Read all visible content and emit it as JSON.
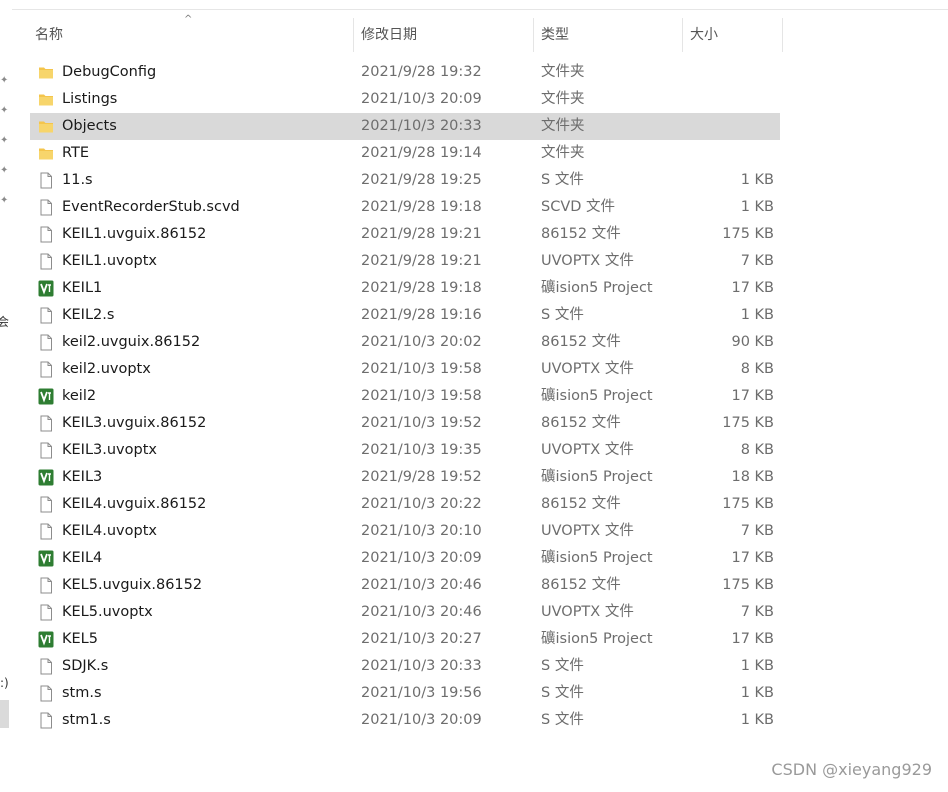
{
  "columns": {
    "name": "名称",
    "date": "修改日期",
    "type": "类型",
    "size": "大小"
  },
  "files": [
    {
      "name": "DebugConfig",
      "date": "2021/9/28 19:32",
      "type": "文件夹",
      "size": "",
      "icon": "folder-icon"
    },
    {
      "name": "Listings",
      "date": "2021/10/3 20:09",
      "type": "文件夹",
      "size": "",
      "icon": "folder-icon"
    },
    {
      "name": "Objects",
      "date": "2021/10/3 20:33",
      "type": "文件夹",
      "size": "",
      "icon": "folder-icon",
      "selected": true
    },
    {
      "name": "RTE",
      "date": "2021/9/28 19:14",
      "type": "文件夹",
      "size": "",
      "icon": "folder-icon"
    },
    {
      "name": "11.s",
      "date": "2021/9/28 19:25",
      "type": "S 文件",
      "size": "1 KB",
      "icon": "file-icon"
    },
    {
      "name": "EventRecorderStub.scvd",
      "date": "2021/9/28 19:18",
      "type": "SCVD 文件",
      "size": "1 KB",
      "icon": "file-icon"
    },
    {
      "name": "KEIL1.uvguix.86152",
      "date": "2021/9/28 19:21",
      "type": "86152 文件",
      "size": "175 KB",
      "icon": "file-icon"
    },
    {
      "name": "KEIL1.uvoptx",
      "date": "2021/9/28 19:21",
      "type": "UVOPTX 文件",
      "size": "7 KB",
      "icon": "file-icon"
    },
    {
      "name": "KEIL1",
      "date": "2021/9/28 19:18",
      "type": "礦ision5 Project",
      "size": "17 KB",
      "icon": "keil-project-icon"
    },
    {
      "name": "KEIL2.s",
      "date": "2021/9/28 19:16",
      "type": "S 文件",
      "size": "1 KB",
      "icon": "file-icon"
    },
    {
      "name": "keil2.uvguix.86152",
      "date": "2021/10/3 20:02",
      "type": "86152 文件",
      "size": "90 KB",
      "icon": "file-icon"
    },
    {
      "name": "keil2.uvoptx",
      "date": "2021/10/3 19:58",
      "type": "UVOPTX 文件",
      "size": "8 KB",
      "icon": "file-icon"
    },
    {
      "name": "keil2",
      "date": "2021/10/3 19:58",
      "type": "礦ision5 Project",
      "size": "17 KB",
      "icon": "keil-project-icon"
    },
    {
      "name": "KEIL3.uvguix.86152",
      "date": "2021/10/3 19:52",
      "type": "86152 文件",
      "size": "175 KB",
      "icon": "file-icon"
    },
    {
      "name": "KEIL3.uvoptx",
      "date": "2021/10/3 19:35",
      "type": "UVOPTX 文件",
      "size": "8 KB",
      "icon": "file-icon"
    },
    {
      "name": "KEIL3",
      "date": "2021/9/28 19:52",
      "type": "礦ision5 Project",
      "size": "18 KB",
      "icon": "keil-project-icon"
    },
    {
      "name": "KEIL4.uvguix.86152",
      "date": "2021/10/3 20:22",
      "type": "86152 文件",
      "size": "175 KB",
      "icon": "file-icon"
    },
    {
      "name": "KEIL4.uvoptx",
      "date": "2021/10/3 20:10",
      "type": "UVOPTX 文件",
      "size": "7 KB",
      "icon": "file-icon"
    },
    {
      "name": "KEIL4",
      "date": "2021/10/3 20:09",
      "type": "礦ision5 Project",
      "size": "17 KB",
      "icon": "keil-project-icon"
    },
    {
      "name": "KEL5.uvguix.86152",
      "date": "2021/10/3 20:46",
      "type": "86152 文件",
      "size": "175 KB",
      "icon": "file-icon"
    },
    {
      "name": "KEL5.uvoptx",
      "date": "2021/10/3 20:46",
      "type": "UVOPTX 文件",
      "size": "7 KB",
      "icon": "file-icon"
    },
    {
      "name": "KEL5",
      "date": "2021/10/3 20:27",
      "type": "礦ision5 Project",
      "size": "17 KB",
      "icon": "keil-project-icon"
    },
    {
      "name": "SDJK.s",
      "date": "2021/10/3 20:33",
      "type": "S 文件",
      "size": "1 KB",
      "icon": "file-icon"
    },
    {
      "name": "stm.s",
      "date": "2021/10/3 19:56",
      "type": "S 文件",
      "size": "1 KB",
      "icon": "file-icon"
    },
    {
      "name": "stm1.s",
      "date": "2021/10/3 20:09",
      "type": "S 文件",
      "size": "1 KB",
      "icon": "file-icon"
    }
  ],
  "nav_fragments": {
    "a": "会",
    "b": ":)"
  },
  "watermark": "CSDN @xieyang929",
  "colors": {
    "folder": "#f4c54c",
    "keil": "#2e7d32",
    "selection": "#d9d9d9"
  }
}
